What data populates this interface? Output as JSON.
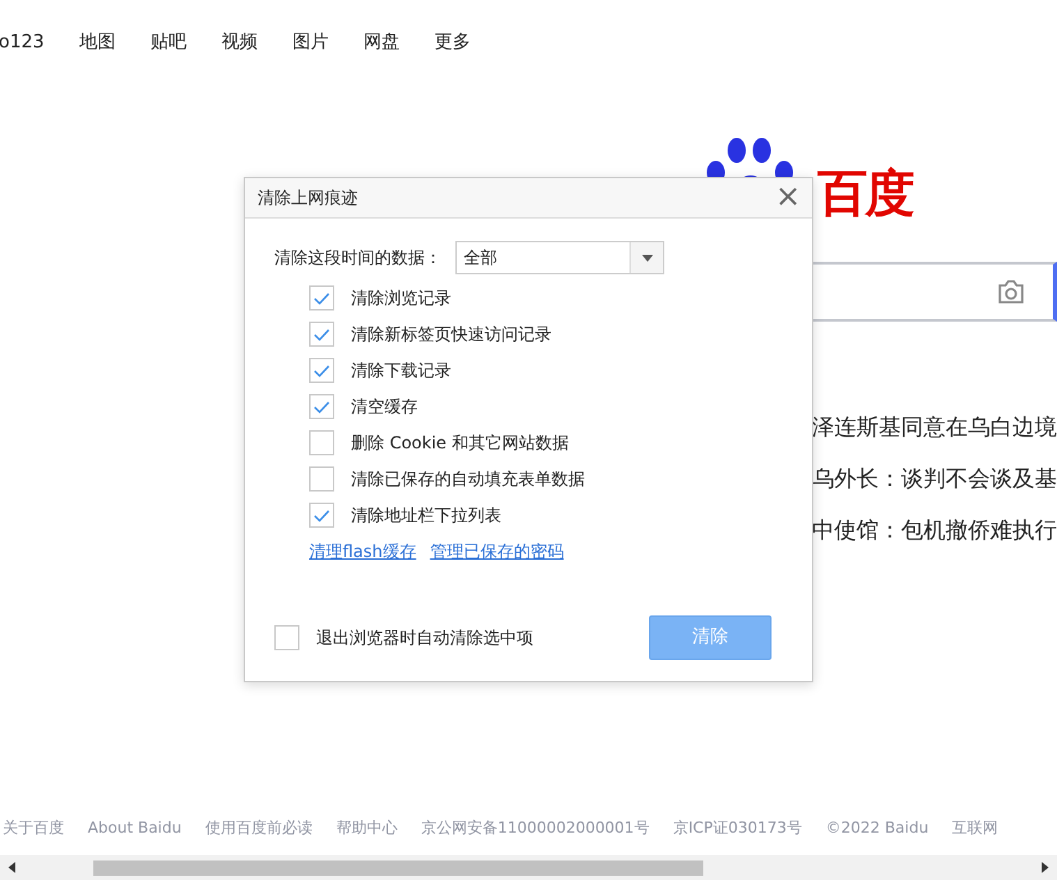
{
  "top_nav": [
    {
      "label": "o123"
    },
    {
      "label": "地图"
    },
    {
      "label": "贴吧"
    },
    {
      "label": "视频"
    },
    {
      "label": "图片"
    },
    {
      "label": "网盘"
    },
    {
      "label": "更多"
    }
  ],
  "logo": {
    "text": "百度"
  },
  "news": [
    "泽连斯基同意在乌白边境",
    "乌外长：谈判不会谈及基",
    "中使馆：包机撤侨难执行"
  ],
  "footer": [
    "关于百度",
    "About Baidu",
    "使用百度前必读",
    "帮助中心",
    "京公网安备11000002000001号",
    "京ICP证030173号",
    "©2022 Baidu",
    "互联网"
  ],
  "dialog": {
    "title": "清除上网痕迹",
    "close": "×",
    "range_label": "清除这段时间的数据：",
    "range_value": "全部",
    "options": [
      {
        "label": "清除浏览记录",
        "checked": true
      },
      {
        "label": "清除新标签页快速访问记录",
        "checked": true
      },
      {
        "label": "清除下载记录",
        "checked": true
      },
      {
        "label": "清空缓存",
        "checked": true
      },
      {
        "label": "删除 Cookie 和其它网站数据",
        "checked": false
      },
      {
        "label": "清除已保存的自动填充表单数据",
        "checked": false
      },
      {
        "label": "清除地址栏下拉列表",
        "checked": true
      }
    ],
    "links": [
      "清理flash缓存",
      "管理已保存的密码"
    ],
    "auto_clear": {
      "label": "退出浏览器时自动清除选中项",
      "checked": false
    },
    "button": {
      "label": "清除",
      "disabled": true
    }
  }
}
